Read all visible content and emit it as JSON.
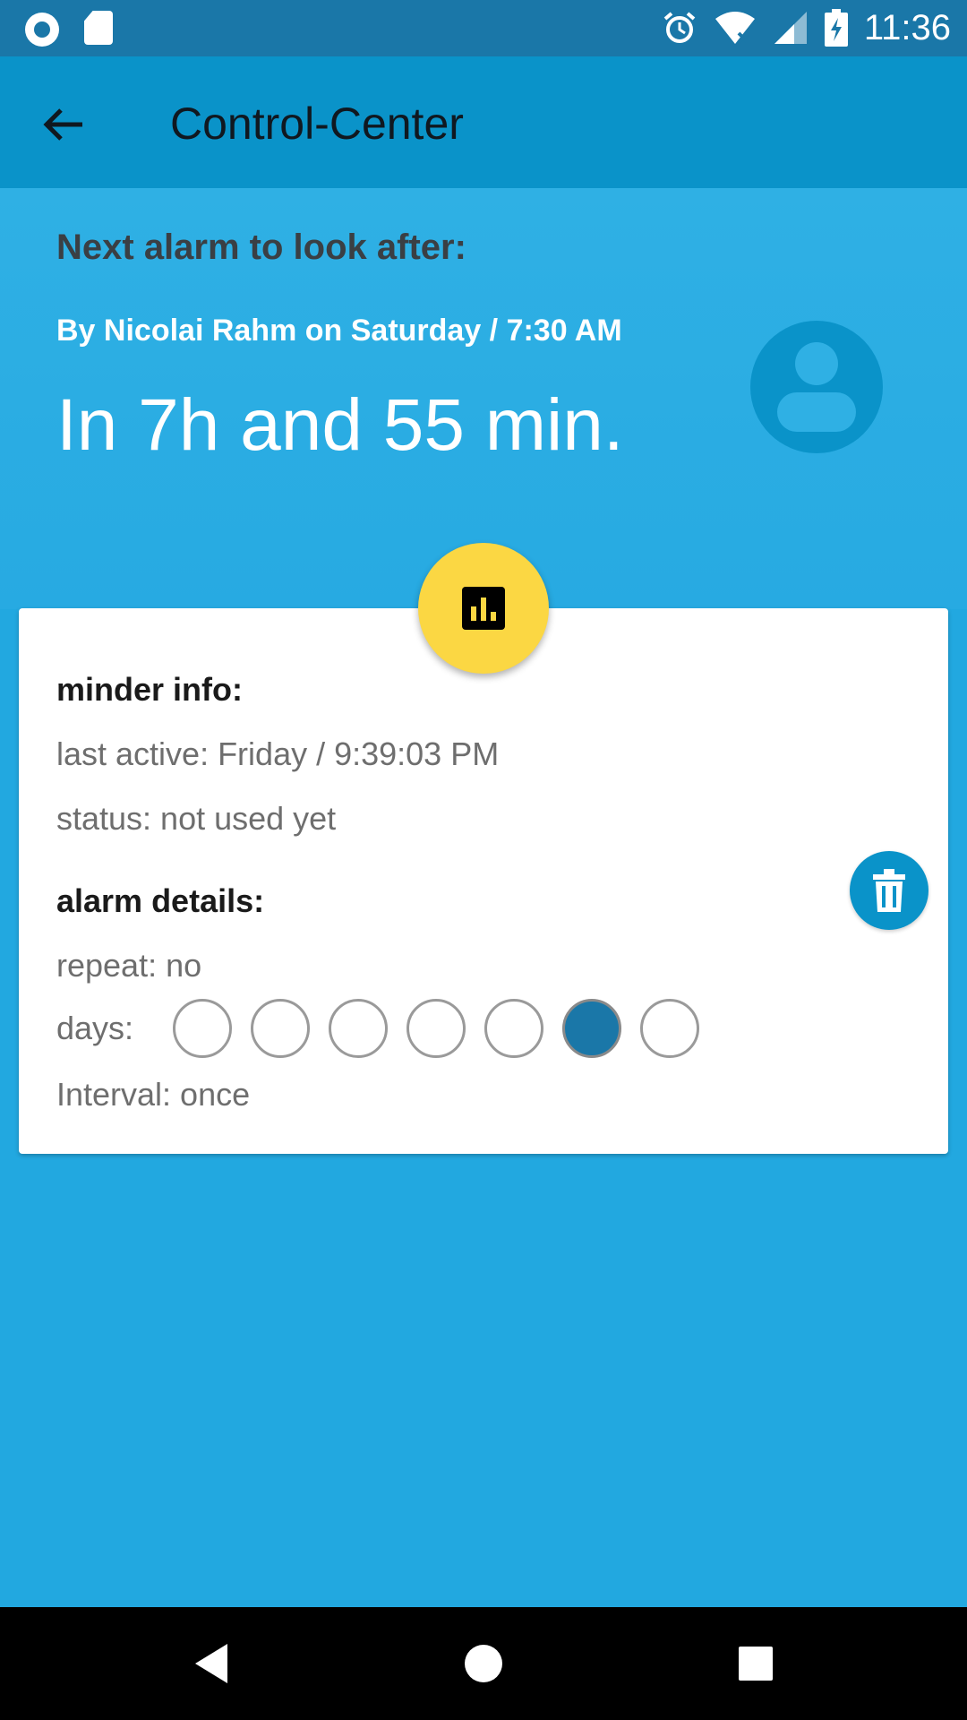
{
  "status_bar": {
    "time": "11:36",
    "icons": [
      "record-icon",
      "sd-card-icon",
      "alarm-icon",
      "wifi-icon",
      "signal-icon",
      "battery-charging-icon"
    ]
  },
  "app_bar": {
    "title": "Control-Center",
    "back_icon": "arrow-back-icon"
  },
  "hero": {
    "next_label": "Next alarm to look after:",
    "by_line": "By Nicolai Rahm on Saturday / 7:30 AM",
    "countdown": "In 7h and 55 min.",
    "avatar_icon": "person-icon"
  },
  "card": {
    "minder_header": "minder info:",
    "last_active": "last active: Friday / 9:39:03 PM",
    "status": "status: not used yet",
    "alarm_header": "alarm details:",
    "repeat": "repeat: no",
    "days_label": "days:",
    "days_selected": [
      false,
      false,
      false,
      false,
      false,
      true,
      false
    ],
    "interval": "Interval: once"
  },
  "buttons": {
    "stats_icon": "bar-chart-icon",
    "delete_icon": "trash-icon"
  },
  "colors": {
    "status_bar": "#1a77a8",
    "app_bar": "#0a93c9",
    "background": "#22a8e0",
    "fab": "#fbd743",
    "selected_day": "#1a77a8"
  }
}
